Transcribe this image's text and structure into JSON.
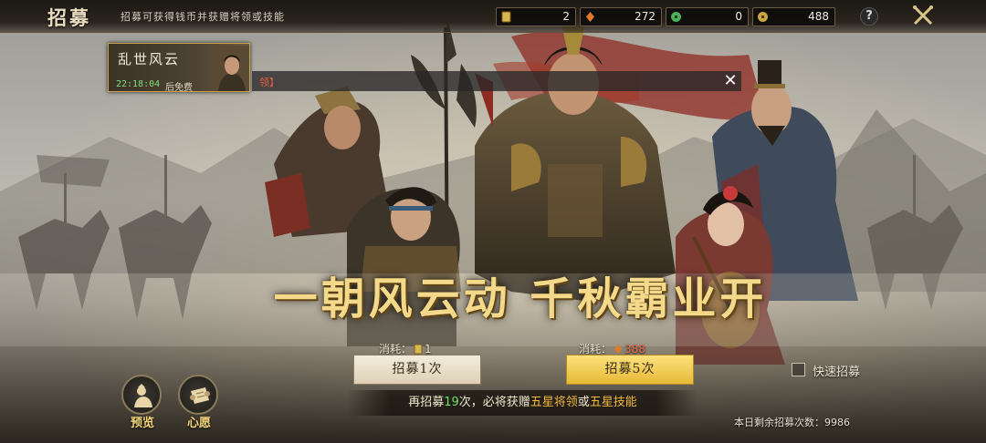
{
  "header": {
    "title": "招募",
    "hint": "招募可获得钱币并获赠将领或技能"
  },
  "resources": [
    {
      "icon": "recruit-token-icon",
      "value": "2",
      "color": "#d8b850"
    },
    {
      "icon": "jade-icon",
      "value": "272",
      "color": "#e07a2a"
    },
    {
      "icon": "copper-coin-icon",
      "value": "0",
      "color": "#4ab05a"
    },
    {
      "icon": "gold-coin-icon",
      "value": "488",
      "color": "#c9a640"
    }
  ],
  "help_label": "?",
  "pool": {
    "name": "乱世风云",
    "timer": "22:18:04",
    "timer_suffix": "后免费"
  },
  "marquee": {
    "text": "领】",
    "close_label": "✕"
  },
  "slogan": "一朝风云动 千秋霸业开",
  "summon_single": {
    "cost_label": "消耗：",
    "cost_value": "1",
    "button_label": "招募1次"
  },
  "summon_five": {
    "cost_label": "消耗：",
    "cost_value": "388",
    "button_label": "招募5次"
  },
  "quick_summon_label": "快速招募",
  "guarantee": {
    "prefix": "再招募",
    "count": "19",
    "middle": "次，必将获赠",
    "item1": "五星将领",
    "or": "或",
    "item2": "五星技能"
  },
  "remaining": {
    "label": "本日剩余招募次数：",
    "value": "9986"
  },
  "side_buttons": {
    "preview_label": "预览",
    "wish_label": "心愿"
  },
  "colors": {
    "accent_gold": "#f4d98a",
    "button_gold": "#e8b936",
    "highlight_green": "#6ee06a"
  }
}
